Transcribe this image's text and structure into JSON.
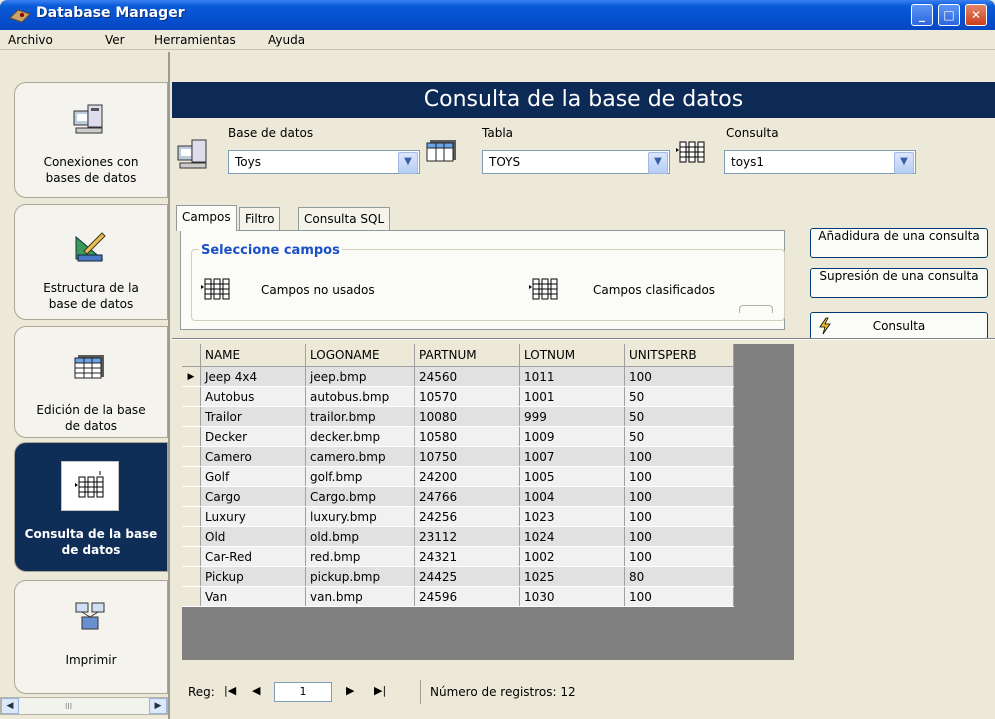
{
  "window": {
    "title": "Database Manager"
  },
  "menu": [
    "Archivo",
    "Ver",
    "Herramientas",
    "Ayuda"
  ],
  "nav": [
    {
      "label1": "Conexiones con",
      "label2": "bases de datos",
      "icon": "computers-icon"
    },
    {
      "label1": "Estructura de la",
      "label2": "base de datos",
      "icon": "ruler-pencil-icon"
    },
    {
      "label1": "Edición de la base",
      "label2": "de datos",
      "icon": "table-icon"
    },
    {
      "label1": "Consulta de la base",
      "label2": "de datos",
      "icon": "query-icon"
    },
    {
      "label1": "Imprimir",
      "label2": "",
      "icon": "printer-icon"
    }
  ],
  "header": {
    "title": "Consulta de la base de datos"
  },
  "selectors": {
    "db_label": "Base de datos",
    "db_value": "Toys",
    "table_label": "Tabla",
    "table_value": "TOYS",
    "query_label": "Consulta",
    "query_value": "toys1"
  },
  "tabs": [
    "Campos",
    "Filtro",
    "Consulta SQL"
  ],
  "fields": {
    "group_title": "Seleccione campos",
    "unused": "Campos no usados",
    "sorted": "Campos clasificados"
  },
  "buttons": {
    "add_query": "Añadidura de una consulta",
    "delete_query": "Supresión de una consulta",
    "run_query": "Consulta"
  },
  "grid": {
    "columns": [
      "NAME",
      "LOGONAME",
      "PARTNUM",
      "LOTNUM",
      "UNITSPERB"
    ],
    "rows": [
      [
        "Jeep 4x4",
        "jeep.bmp",
        "24560",
        "1011",
        "100"
      ],
      [
        "Autobus",
        "autobus.bmp",
        "10570",
        "1001",
        "50"
      ],
      [
        "Trailor",
        "trailor.bmp",
        "10080",
        "999",
        "50"
      ],
      [
        "Decker",
        "decker.bmp",
        "10580",
        "1009",
        "50"
      ],
      [
        "Camero",
        "camero.bmp",
        "10750",
        "1007",
        "100"
      ],
      [
        "Golf",
        "golf.bmp",
        "24200",
        "1005",
        "100"
      ],
      [
        "Cargo",
        "Cargo.bmp",
        "24766",
        "1004",
        "100"
      ],
      [
        "Luxury",
        "luxury.bmp",
        "24256",
        "1023",
        "100"
      ],
      [
        "Old",
        "old.bmp",
        "23112",
        "1024",
        "100"
      ],
      [
        "Car-Red",
        "red.bmp",
        "24321",
        "1002",
        "100"
      ],
      [
        "Pickup",
        "pickup.bmp",
        "24425",
        "1025",
        "80"
      ],
      [
        "Van",
        "van.bmp",
        "24596",
        "1030",
        "100"
      ]
    ]
  },
  "footer": {
    "reg_label": "Reg:",
    "current": "1",
    "count_label": "Número de registros: 12"
  },
  "colors": {
    "titlebar": "#0550d0",
    "header": "#0d2a56",
    "active_nav": "#0e2d57"
  }
}
